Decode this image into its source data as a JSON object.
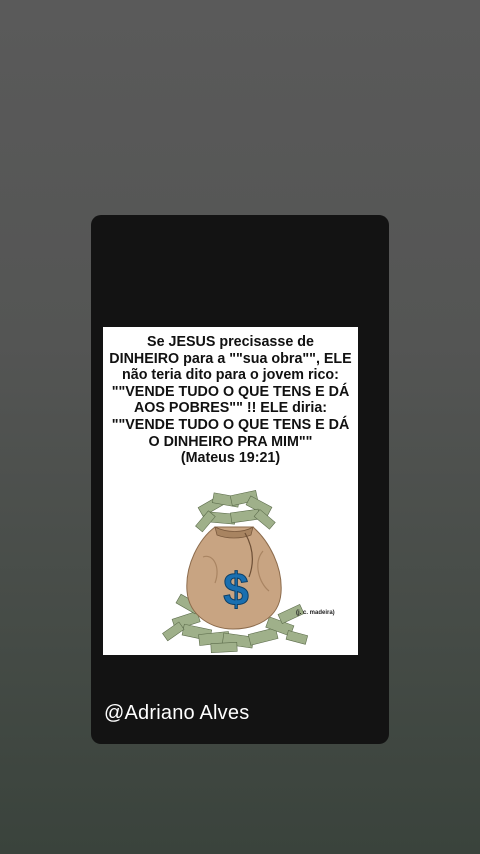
{
  "story": {
    "quote_lines": [
      "Se JESUS precisasse de",
      "DINHEIRO para a \"\"sua obra\"\", ELE",
      "não teria dito para o jovem rico:",
      "\"\"VENDE TUDO O QUE TENS E DÁ",
      "AOS POBRES\"\" !!  ELE diria:",
      "\"\"VENDE TUDO O QUE TENS E DÁ",
      "O DINHEIRO PRA MIM\"\"",
      "(Mateus 19:21)"
    ],
    "credit": "(j. c. madeira)",
    "username": "@Adriano Alves",
    "colors": {
      "card_background": "#131313",
      "dollar_sign": "#1a6fb0",
      "bag": "#c8a482",
      "bills": "#9fb08a"
    },
    "illustration_icon": "money-bag-dollar-icon"
  }
}
